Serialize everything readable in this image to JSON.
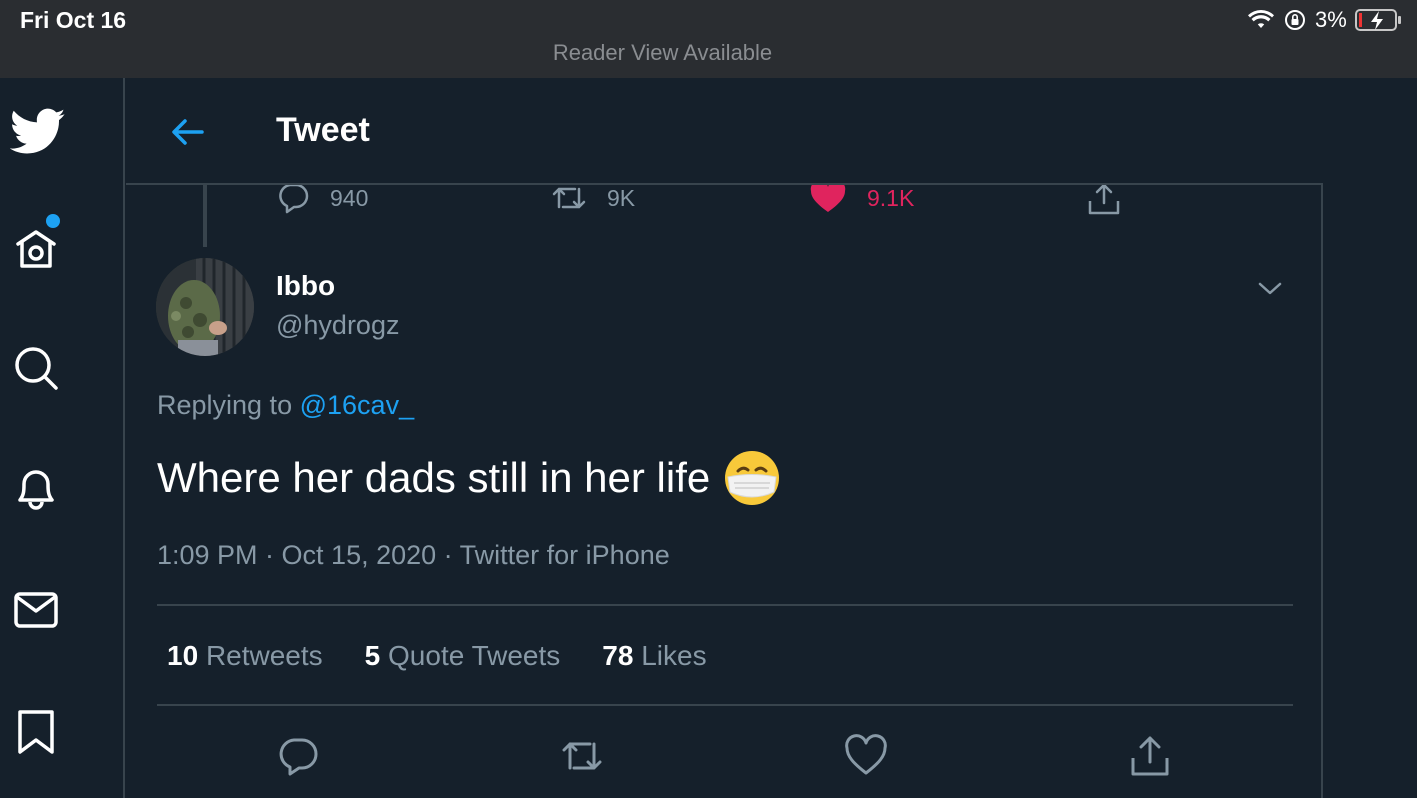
{
  "status_bar": {
    "date": "Fri Oct 16",
    "reader_view": "Reader View Available",
    "battery_percent": "3%",
    "icons": [
      "wifi-icon",
      "orientation-lock-icon",
      "battery-charging-icon"
    ]
  },
  "sidebar": {
    "items": [
      {
        "name": "twitter-logo-icon"
      },
      {
        "name": "home-icon",
        "has_dot": true
      },
      {
        "name": "search-icon"
      },
      {
        "name": "notifications-icon"
      },
      {
        "name": "messages-icon"
      },
      {
        "name": "bookmarks-icon"
      }
    ]
  },
  "header": {
    "title": "Tweet"
  },
  "previous_tweet_actions": {
    "replies": "940",
    "retweets": "9K",
    "likes": "9.1K"
  },
  "tweet": {
    "display_name": "Ibbo",
    "handle": "@hydrogz",
    "replying_prefix": "Replying to",
    "replying_to": "@16cav_",
    "text": "Where her dads still in her life",
    "emoji": "face-with-medical-mask",
    "timestamp": "1:09 PM · Oct 15, 2020 · Twitter for iPhone"
  },
  "stats": {
    "retweets_count": "10",
    "retweets_label": "Retweets",
    "quotes_count": "5",
    "quotes_label": "Quote Tweets",
    "likes_count": "78",
    "likes_label": "Likes"
  },
  "colors": {
    "background": "#15202b",
    "accent": "#1da1f2",
    "like": "#e0245e",
    "secondary_text": "#8899a6",
    "border": "#38444d"
  }
}
